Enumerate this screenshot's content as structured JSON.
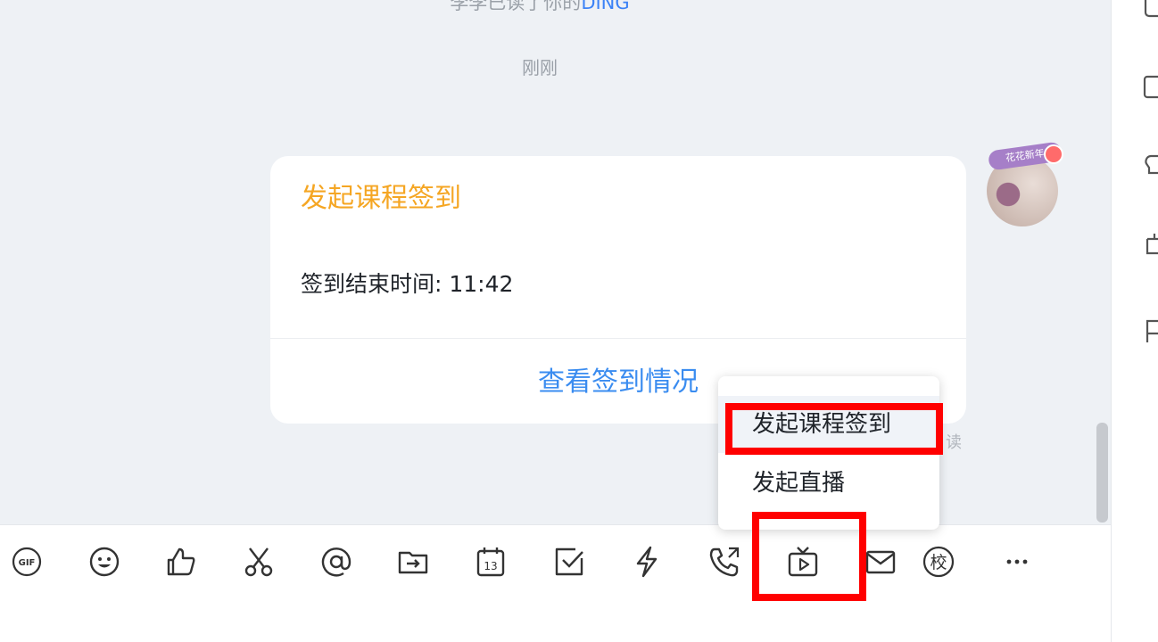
{
  "chat": {
    "system_notice": {
      "prefix": "李李已读了你的",
      "ding": "DING"
    },
    "timestamp": "刚刚",
    "card": {
      "title": "发起课程签到",
      "body": "签到结束时间: 11:42",
      "action": "查看签到情况"
    },
    "read_status": "读",
    "avatar_badge": "花花新年"
  },
  "popup": {
    "items": [
      {
        "label": "发起课程签到"
      },
      {
        "label": "发起直播"
      }
    ]
  },
  "toolbar": {
    "icons": [
      "gif-icon",
      "emoji-icon",
      "thumbs-up-icon",
      "scissors-icon",
      "at-icon",
      "file-transfer-icon",
      "calendar-icon",
      "task-check-icon",
      "flash-icon",
      "phone-callback-icon",
      "live-tv-icon",
      "mail-icon",
      "school-icon",
      "more-icon"
    ],
    "calendar_day": "13",
    "school_char": "校",
    "gif_text": "GIF"
  },
  "colors": {
    "accent": "#3a8cf0",
    "card_title": "#f5a623",
    "highlight": "#ff0000",
    "chat_bg": "#eef1f5"
  }
}
